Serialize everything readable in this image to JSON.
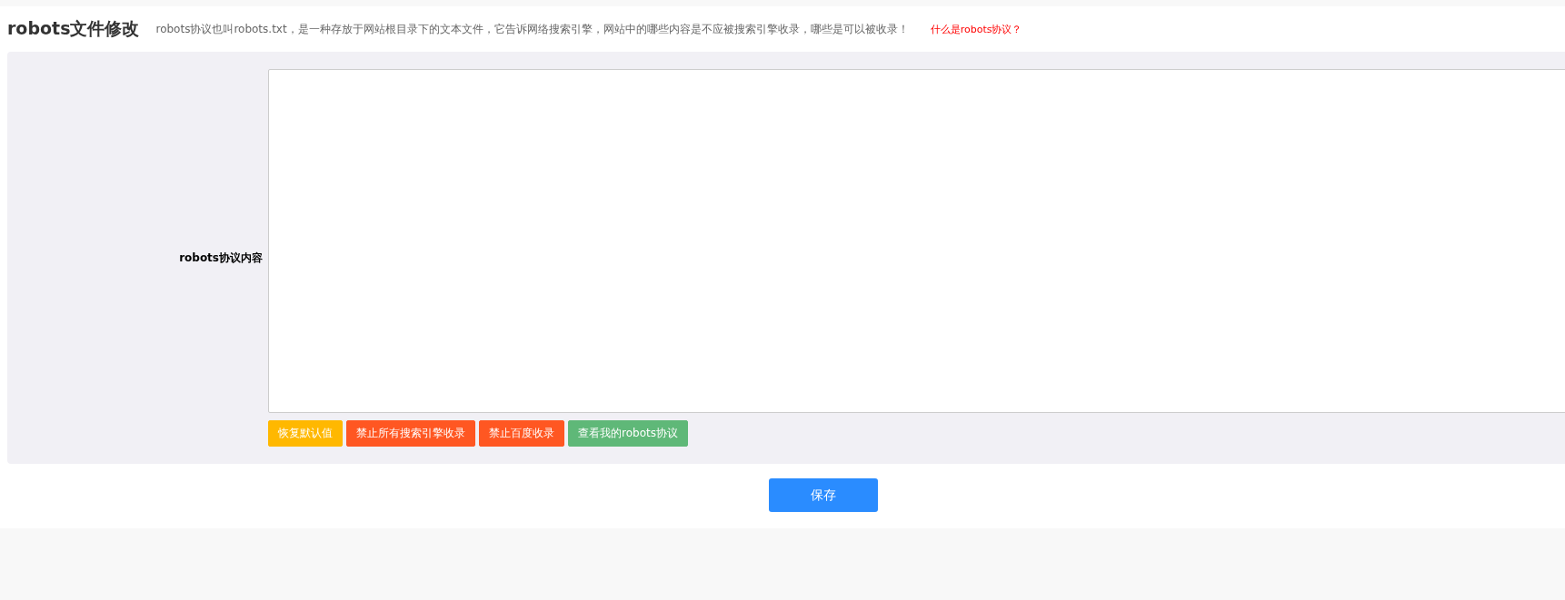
{
  "header": {
    "title": "robots文件修改",
    "description": "robots协议也叫robots.txt，是一种存放于网站根目录下的文本文件，它告诉网络搜索引擎，网站中的哪些内容是不应被搜索引擎收录，哪些是可以被收录！",
    "help_link": "什么是robots协议？"
  },
  "form": {
    "label": "robots协议内容",
    "buttons": [
      {
        "label": "恢复默认值",
        "color": "#ffb800"
      },
      {
        "label": "禁止所有搜索引擎收录",
        "color": "#ff5722"
      },
      {
        "label": "禁止百度收录",
        "color": "#ff5722"
      },
      {
        "label": "查看我的robots协议",
        "color": "#5fb878"
      }
    ]
  },
  "save_button": "保存"
}
